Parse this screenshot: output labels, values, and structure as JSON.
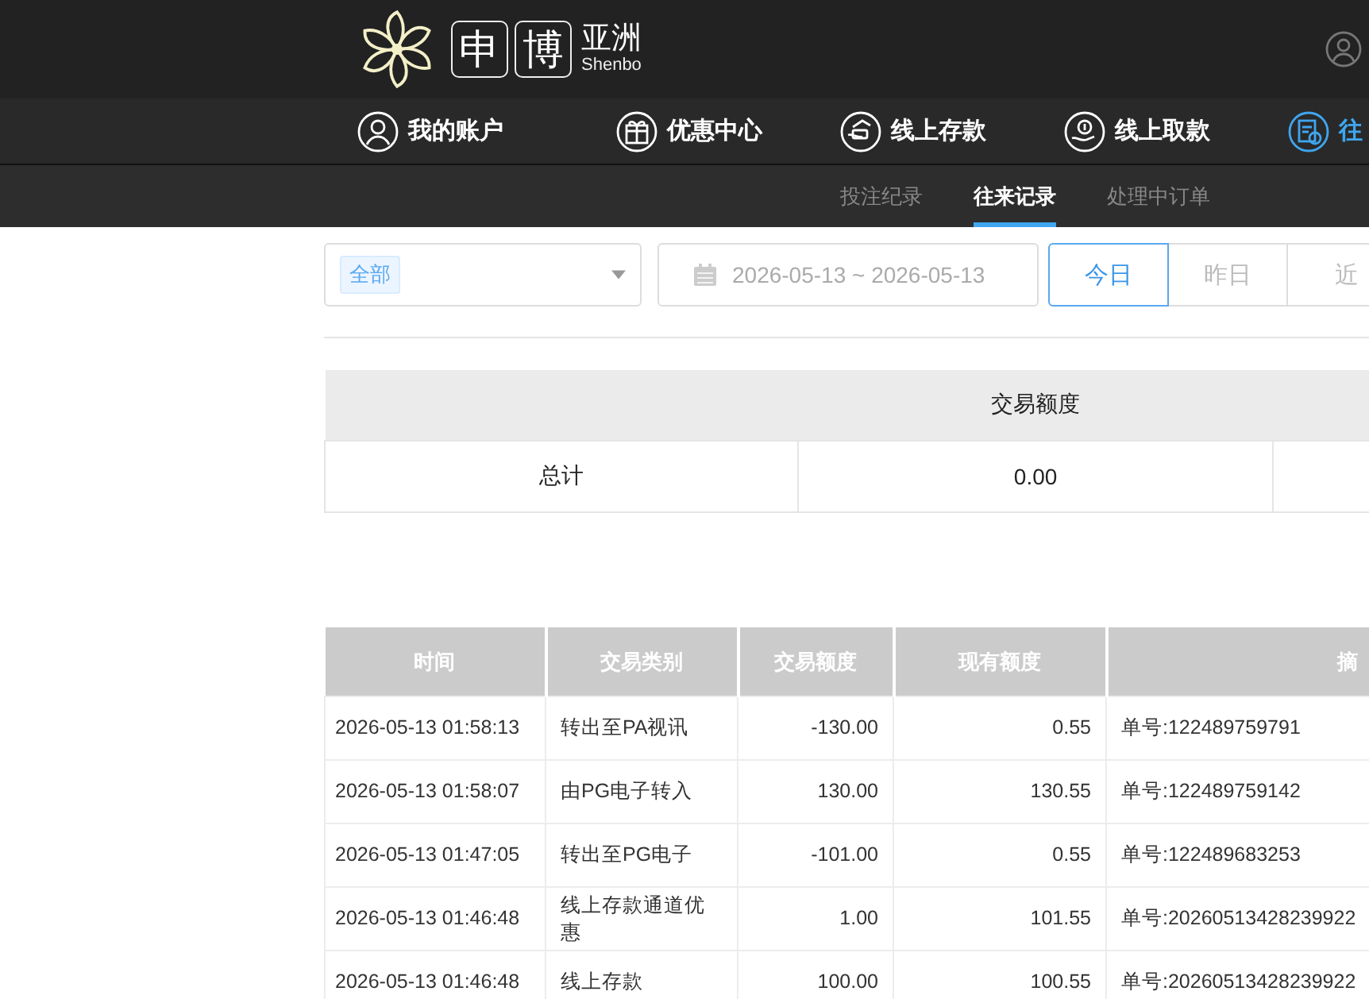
{
  "logo": {
    "chars": [
      "申",
      "博"
    ],
    "region": "亚洲",
    "latin": "Shenbo"
  },
  "nav": [
    {
      "label": "我的账户",
      "selected": false
    },
    {
      "label": "优惠中心",
      "selected": false
    },
    {
      "label": "线上存款",
      "selected": false
    },
    {
      "label": "线上取款",
      "selected": false
    },
    {
      "label": "往",
      "selected": true
    }
  ],
  "subnav": [
    {
      "label": "投注纪录",
      "selected": false
    },
    {
      "label": "往来记录",
      "selected": true
    },
    {
      "label": "处理中订单",
      "selected": false
    }
  ],
  "filter": {
    "type_tag": "全部",
    "date_range": "2026-05-13 ~ 2026-05-13",
    "ranges": [
      {
        "label": "今日",
        "selected": true
      },
      {
        "label": "昨日",
        "selected": false
      },
      {
        "label": "近",
        "selected": false
      }
    ]
  },
  "summary": {
    "header": "交易额度",
    "cells": [
      "总计",
      "0.00"
    ]
  },
  "table": {
    "columns": [
      "时间",
      "交易类别",
      "交易额度",
      "现有额度",
      "摘"
    ],
    "rows": [
      [
        "2026-05-13 01:58:13",
        "转出至PA视讯",
        "-130.00",
        "0.55",
        "单号:122489759791"
      ],
      [
        "2026-05-13 01:58:07",
        "由PG电子转入",
        "130.00",
        "130.55",
        "单号:122489759142"
      ],
      [
        "2026-05-13 01:47:05",
        "转出至PG电子",
        "-101.00",
        "0.55",
        "单号:122489683253"
      ],
      [
        "2026-05-13 01:46:48",
        "线上存款通道优惠",
        "1.00",
        "101.55",
        "单号:20260513428239922"
      ],
      [
        "2026-05-13 01:46:48",
        "线上存款",
        "100.00",
        "100.55",
        "单号:20260513428239922"
      ]
    ]
  }
}
